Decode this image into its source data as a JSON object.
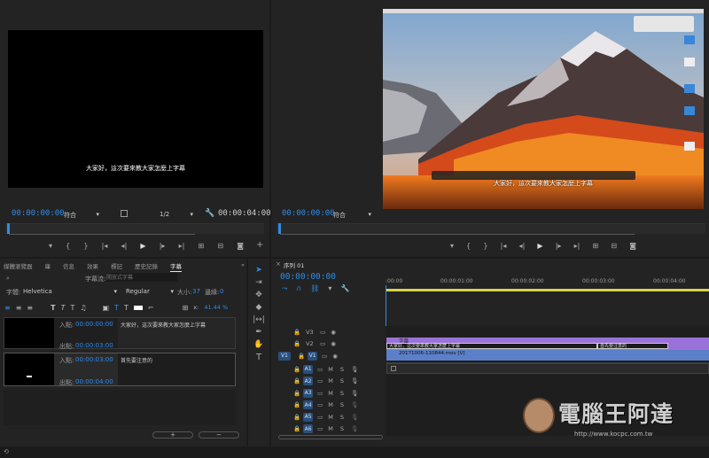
{
  "source_monitor": {
    "caption": "大家好，這次要來教大家怎麼上字幕",
    "timecode_in": "00:00:00:00",
    "fit": "符合",
    "resolution": "1/2",
    "timecode_out": "00:00:04:00"
  },
  "program_monitor": {
    "caption": "大家好，這次要來教大家怎麼上字幕",
    "timecode_in": "00:00:00:00",
    "fit": "符合"
  },
  "captions_panel": {
    "tabs": [
      "媒體瀏覽器",
      "庫",
      "信息",
      "效果",
      "標記",
      "歷史記錄",
      "字幕"
    ],
    "active_tab": "字幕",
    "search_label": "字幕流:",
    "search_placeholder": "開放式字幕",
    "font_label": "字體:",
    "font_value": "Helvetica",
    "style_value": "Regular",
    "size_label": "大小:",
    "size_value": "37",
    "edge_label": "邊緣:",
    "edge_value": "0",
    "x_label": "x:",
    "x_value": "41.44 %",
    "entries": [
      {
        "in_label": "入點:",
        "in_tc": "00:00:00:00",
        "out_label": "出點:",
        "out_tc": "00:00:03:00",
        "text": "大家好，這次要來教大家怎麼上字幕"
      },
      {
        "in_label": "入點:",
        "in_tc": "00:00:03:00",
        "out_label": "出點:",
        "out_tc": "00:00:04:00",
        "text": "首先要注意的"
      }
    ],
    "add_btn": "+",
    "remove_btn": "−"
  },
  "timeline": {
    "tab": "序列 01",
    "timecode": "00:00:00:00",
    "ruler_labels": [
      ":00:00",
      "00:00:01:00",
      "00:00:02:00",
      "00:00:03:00",
      "00:00:04:00"
    ],
    "video_tracks": [
      "V3",
      "V2",
      "V1"
    ],
    "audio_tracks": [
      "A1",
      "A2",
      "A3",
      "A4",
      "A5",
      "A6"
    ],
    "src_patch": "V1",
    "caption_clip_label": "字幕",
    "caption_seg1": "大家好，這次要來教大家怎麼上字幕",
    "caption_seg2": "首先要注意的",
    "video_clip_label": "20171006-110844.mov [V]",
    "m_label": "M",
    "s_label": "S"
  },
  "watermark": {
    "brand": "電腦王阿達",
    "url": "http://www.kocpc.com.tw"
  },
  "colors": {
    "accent": "#2d8ceb",
    "caption_clip": "#9b72d9",
    "video_clip": "#5b7fc9"
  }
}
